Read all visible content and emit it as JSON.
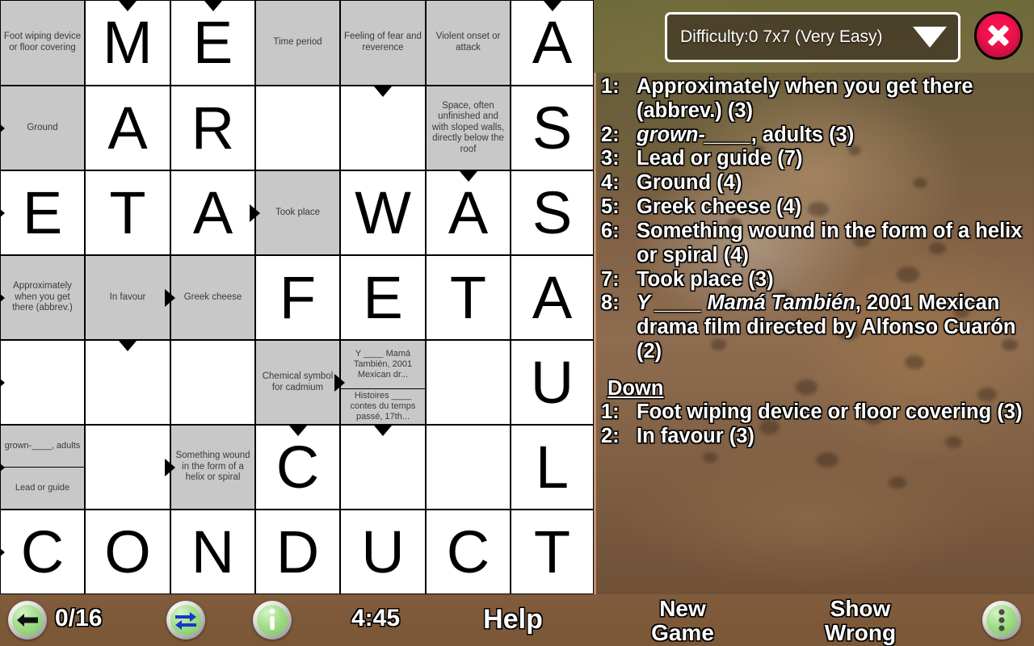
{
  "app": {
    "title": "Crossword Puzzle",
    "background_image": "blurred-leopard-photo"
  },
  "header": {
    "difficulty_label": "Difficulty:0  7x7  (Very Easy)",
    "dropdown_icon": "chevron-down-icon",
    "close_icon": "close-icon",
    "close_color": "#f5134f"
  },
  "grid": {
    "size": "7x7",
    "rows": 7,
    "cols": 7,
    "cells": [
      {
        "r": 0,
        "c": 0,
        "type": "clue",
        "clue": "Foot wiping device or floor covering"
      },
      {
        "r": 0,
        "c": 1,
        "type": "letter",
        "letter": "M",
        "arrow": "down"
      },
      {
        "r": 0,
        "c": 2,
        "type": "letter",
        "letter": "E",
        "arrow": "down"
      },
      {
        "r": 0,
        "c": 3,
        "type": "clue",
        "clue": "Time period"
      },
      {
        "r": 0,
        "c": 4,
        "type": "clue",
        "clue": "Feeling of fear and reverence"
      },
      {
        "r": 0,
        "c": 5,
        "type": "clue",
        "clue": "Violent onset or attack"
      },
      {
        "r": 0,
        "c": 6,
        "type": "letter",
        "letter": "A",
        "arrow": "down"
      },
      {
        "r": 1,
        "c": 0,
        "type": "clue",
        "clue": "Ground",
        "arrow": "right"
      },
      {
        "r": 1,
        "c": 1,
        "type": "letter",
        "letter": "A"
      },
      {
        "r": 1,
        "c": 2,
        "type": "letter",
        "letter": "R"
      },
      {
        "r": 1,
        "c": 3,
        "type": "letter",
        "letter": ""
      },
      {
        "r": 1,
        "c": 4,
        "type": "letter",
        "letter": "",
        "arrow": "down"
      },
      {
        "r": 1,
        "c": 5,
        "type": "clue",
        "clue": "Space, often unfinished and with sloped walls, directly below the roof"
      },
      {
        "r": 1,
        "c": 6,
        "type": "letter",
        "letter": "S"
      },
      {
        "r": 2,
        "c": 0,
        "type": "letter",
        "letter": "E",
        "arrow": "right"
      },
      {
        "r": 2,
        "c": 1,
        "type": "letter",
        "letter": "T"
      },
      {
        "r": 2,
        "c": 2,
        "type": "letter",
        "letter": "A"
      },
      {
        "r": 2,
        "c": 3,
        "type": "clue",
        "clue": "Took place",
        "arrow": "right"
      },
      {
        "r": 2,
        "c": 4,
        "type": "letter",
        "letter": "W"
      },
      {
        "r": 2,
        "c": 5,
        "type": "letter",
        "letter": "A",
        "arrow": "down"
      },
      {
        "r": 2,
        "c": 6,
        "type": "letter",
        "letter": "S"
      },
      {
        "r": 3,
        "c": 0,
        "type": "clue",
        "clue": "Approximately when you get there (abbrev.)",
        "arrow": "right"
      },
      {
        "r": 3,
        "c": 1,
        "type": "clue",
        "clue": "In favour"
      },
      {
        "r": 3,
        "c": 2,
        "type": "clue",
        "clue": "Greek cheese",
        "arrow": "right"
      },
      {
        "r": 3,
        "c": 3,
        "type": "letter",
        "letter": "F"
      },
      {
        "r": 3,
        "c": 4,
        "type": "letter",
        "letter": "E"
      },
      {
        "r": 3,
        "c": 5,
        "type": "letter",
        "letter": "T"
      },
      {
        "r": 3,
        "c": 6,
        "type": "letter",
        "letter": "A"
      },
      {
        "r": 4,
        "c": 0,
        "type": "letter",
        "letter": "",
        "arrow": "right"
      },
      {
        "r": 4,
        "c": 1,
        "type": "letter",
        "letter": "",
        "arrow": "down"
      },
      {
        "r": 4,
        "c": 2,
        "type": "letter",
        "letter": ""
      },
      {
        "r": 4,
        "c": 3,
        "type": "clue",
        "clue": "Chemical symbol for cadmium"
      },
      {
        "r": 4,
        "c": 4,
        "type": "split",
        "clue_top": "Y ____ Mamá También, 2001 Mexican dr...",
        "clue_bottom": "Histoires ____ contes du temps passé, 17th...",
        "arrow": "right"
      },
      {
        "r": 4,
        "c": 5,
        "type": "letter",
        "letter": ""
      },
      {
        "r": 4,
        "c": 6,
        "type": "letter",
        "letter": "U"
      },
      {
        "r": 5,
        "c": 0,
        "type": "split",
        "clue_top": "grown-____, adults",
        "clue_bottom": "Lead or guide",
        "arrow": "right"
      },
      {
        "r": 5,
        "c": 1,
        "type": "letter",
        "letter": ""
      },
      {
        "r": 5,
        "c": 2,
        "type": "clue",
        "clue": "Something wound in the form of a helix or spiral",
        "arrow": "right"
      },
      {
        "r": 5,
        "c": 3,
        "type": "letter",
        "letter": "C",
        "arrow": "down"
      },
      {
        "r": 5,
        "c": 4,
        "type": "letter",
        "letter": "",
        "arrow": "down"
      },
      {
        "r": 5,
        "c": 5,
        "type": "letter",
        "letter": ""
      },
      {
        "r": 5,
        "c": 6,
        "type": "letter",
        "letter": "L"
      },
      {
        "r": 6,
        "c": 0,
        "type": "letter",
        "letter": "C",
        "arrow": "right"
      },
      {
        "r": 6,
        "c": 1,
        "type": "letter",
        "letter": "O"
      },
      {
        "r": 6,
        "c": 2,
        "type": "letter",
        "letter": "N"
      },
      {
        "r": 6,
        "c": 3,
        "type": "letter",
        "letter": "D"
      },
      {
        "r": 6,
        "c": 4,
        "type": "letter",
        "letter": "U"
      },
      {
        "r": 6,
        "c": 5,
        "type": "letter",
        "letter": "C"
      },
      {
        "r": 6,
        "c": 6,
        "type": "letter",
        "letter": "T"
      }
    ]
  },
  "clue_panel": {
    "across": [
      {
        "num": "1:",
        "html": "Approximately when you get there (abbrev.) (3)"
      },
      {
        "num": "2:",
        "html": "<i>grown-____</i>, adults (3)"
      },
      {
        "num": "3:",
        "html": "Lead or guide (7)"
      },
      {
        "num": "4:",
        "html": "Ground (4)"
      },
      {
        "num": "5:",
        "html": "Greek cheese (4)"
      },
      {
        "num": "6:",
        "html": "Something wound in the form of a helix or spiral (4)"
      },
      {
        "num": "7:",
        "html": "Took place (3)"
      },
      {
        "num": "8:",
        "html": "<i>Y ____ Mamá También</i>, 2001 Mexican drama film directed by Alfonso Cuarón (2)"
      }
    ],
    "down_heading": "Down",
    "down": [
      {
        "num": "1:",
        "html": "Foot wiping device or floor covering (3)"
      },
      {
        "num": "2:",
        "html": "In favour (3)"
      }
    ]
  },
  "toolbar": {
    "back_icon": "back-arrow-icon",
    "progress": "0/16",
    "swap_icon": "swap-arrows-icon",
    "info_icon": "info-icon",
    "timer": "4:45",
    "help_label": "Help",
    "new_game_label": "New\nGame",
    "new_game_line1": "New",
    "new_game_line2": "Game",
    "show_wrong_line1": "Show",
    "show_wrong_line2": "Wrong",
    "menu_icon": "overflow-menu-icon"
  }
}
